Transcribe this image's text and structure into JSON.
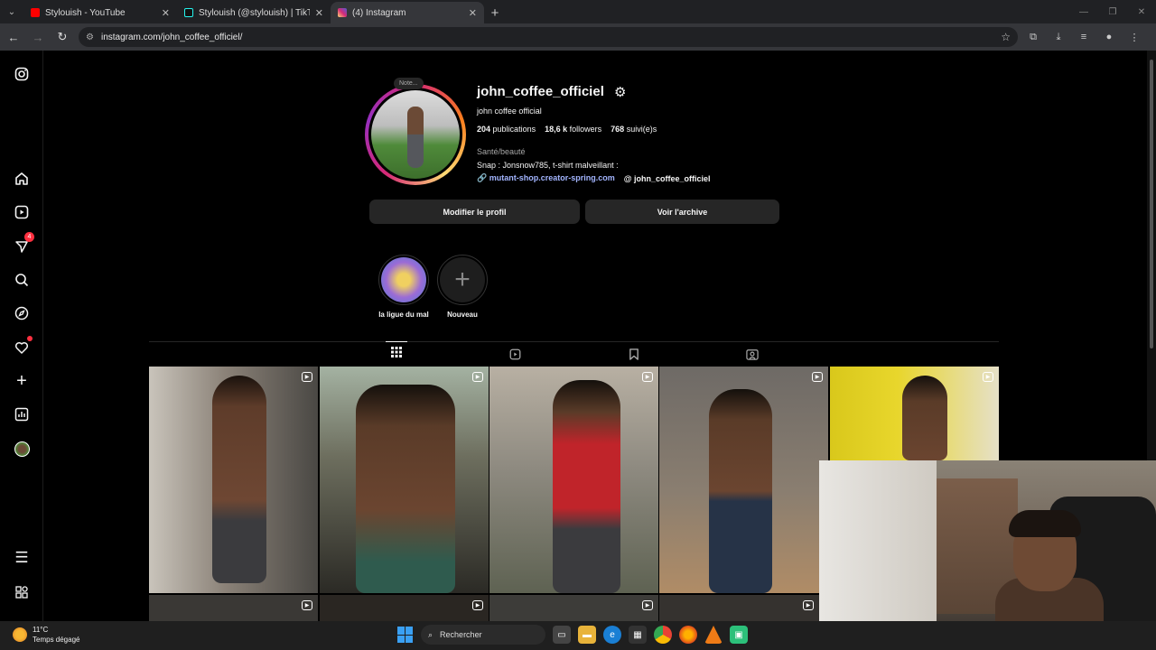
{
  "browser": {
    "tabs": [
      {
        "title": "Stylouish - YouTube",
        "color": "#ff0000"
      },
      {
        "title": "Stylouish (@stylouish) | TikTok",
        "color": "#111111"
      },
      {
        "title": "(4) Instagram",
        "color": "#d62976"
      }
    ],
    "url": "instagram.com/john_coffee_officiel/"
  },
  "sidebar": {
    "notifications_badge": "4"
  },
  "profile": {
    "note": "Note...",
    "username": "john_coffee_officiel",
    "full_name": "john coffee official",
    "posts_count": "204",
    "posts_label": "publications",
    "followers_count": "18,6 k",
    "followers_label": "followers",
    "following_count": "768",
    "following_label": "suivi(e)s",
    "category": "Santé/beauté",
    "bio": "Snap : Jonsnow785, t-shirt malveillant :",
    "link": "mutant-shop.creator-spring.com",
    "threads_handle": "john_coffee_officiel",
    "edit_button": "Modifier le profil",
    "archive_button": "Voir l'archive"
  },
  "highlights": [
    {
      "label": "la ligue du mal"
    },
    {
      "label": "Nouveau"
    }
  ],
  "taskbar": {
    "temperature": "11°C",
    "weather": "Temps dégagé",
    "search_placeholder": "Rechercher"
  }
}
